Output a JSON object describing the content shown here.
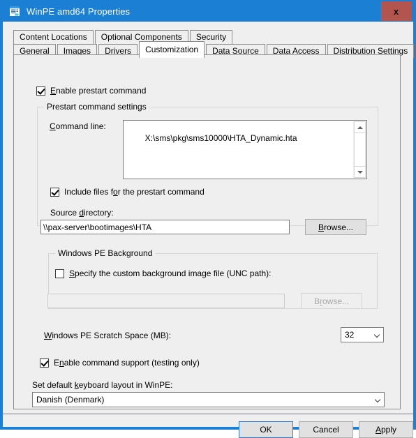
{
  "window": {
    "title": "WinPE amd64 Properties",
    "icon": "window-properties-icon",
    "close_label": "x",
    "titlebar_color": "#1b7fd4",
    "close_button_color": "#b2554e"
  },
  "tabs": {
    "row1": [
      {
        "label": "Content Locations",
        "selected": false
      },
      {
        "label": "Optional Components",
        "selected": false
      },
      {
        "label": "Security",
        "selected": false
      }
    ],
    "row2": [
      {
        "label": "General",
        "selected": false
      },
      {
        "label": "Images",
        "selected": false
      },
      {
        "label": "Drivers",
        "selected": false
      },
      {
        "label": "Customization",
        "selected": true
      },
      {
        "label": "Data Source",
        "selected": false
      },
      {
        "label": "Data Access",
        "selected": false
      },
      {
        "label": "Distribution Settings",
        "selected": false
      }
    ]
  },
  "customization": {
    "enable_prestart": {
      "label_pre": "",
      "label_acc": "E",
      "label_post": "nable prestart command",
      "checked": true
    },
    "prestart_group": {
      "title": "Prestart command settings",
      "command_line_label_acc": "C",
      "command_line_label_post": "ommand line:",
      "command_line_value": "X:\\sms\\pkg\\sms10000\\HTA_Dynamic.hta",
      "include_files": {
        "label_pre": "Include files f",
        "label_acc": "o",
        "label_post": "r the prestart command",
        "checked": true
      },
      "source_dir_label_pre": "Source ",
      "source_dir_label_acc": "d",
      "source_dir_label_post": "irectory:",
      "source_dir_value": "\\\\pax-server\\bootimages\\HTA",
      "browse_label_acc": "B",
      "browse_label_post": "rowse...",
      "browse_enabled": true
    },
    "background_group": {
      "title": "Windows PE Background",
      "specify_custom": {
        "label_pre": "",
        "label_acc": "S",
        "label_post": "pecify the custom background image file (UNC path):",
        "checked": false
      },
      "image_path_value": "",
      "browse_label_pre": "B",
      "browse_label_acc": "r",
      "browse_label_post": "owse...",
      "browse_enabled": false
    },
    "scratch_space": {
      "label_acc": "W",
      "label_post": "indows PE Scratch Space (MB):",
      "value": "32"
    },
    "enable_command_support": {
      "label_pre": "E",
      "label_acc": "n",
      "label_mid": "able command support (testin",
      "label_acc2": "g",
      "label_post": " only)",
      "checked": true
    },
    "keyboard_layout": {
      "label_pre": "Set default ",
      "label_acc": "k",
      "label_post": "eyboard layout in WinPE:",
      "value": "Danish (Denmark)"
    }
  },
  "footer": {
    "ok_label": "OK",
    "cancel_label": "Cancel",
    "apply_label_acc": "A",
    "apply_label_post": "pply"
  }
}
